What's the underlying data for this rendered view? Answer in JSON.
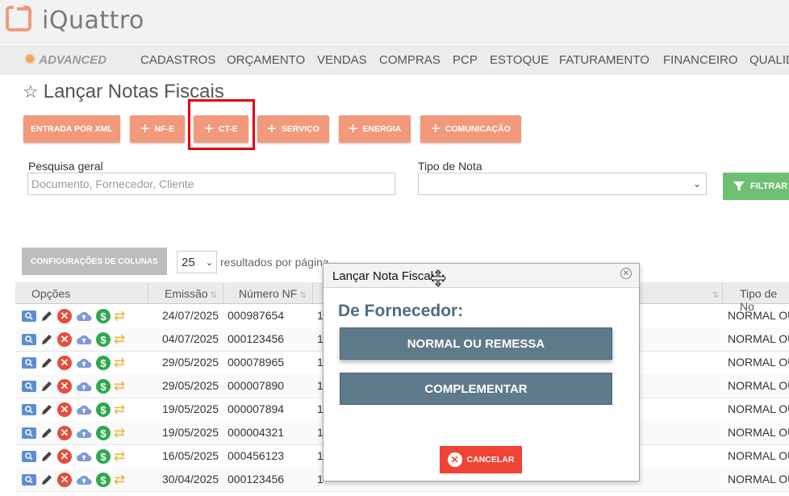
{
  "app": {
    "name": "iQuattro",
    "edition": "ADVANCED"
  },
  "nav": {
    "items": [
      "CADASTROS",
      "ORÇAMENTO",
      "VENDAS",
      "COMPRAS",
      "PCP",
      "ESTOQUE",
      "FATURAMENTO",
      "FINANCEIRO",
      "QUALID"
    ]
  },
  "page": {
    "title": "Lançar Notas Fiscais"
  },
  "actions": {
    "entrada_xml": "ENTRADA POR XML",
    "nfe": "NF-E",
    "cte": "CT-E",
    "servico": "SERVIÇO",
    "energia": "ENERGIA",
    "comunicacao": "COMUNICAÇÃO"
  },
  "filters": {
    "search_label": "Pesquisa geral",
    "search_placeholder": "Documento, Fornecedor, Cliente",
    "tipo_label": "Tipo de Nota",
    "tipo_value": "",
    "filter_button": "FILTRAR"
  },
  "table_controls": {
    "col_config": "CONFIGURAÇÕES DE COLUNAS",
    "page_size": "25",
    "page_size_label": "resultados por página"
  },
  "table": {
    "headers": {
      "opcoes": "Opções",
      "emissao": "Emissão",
      "numero": "Número NF",
      "tipo": "Tipo de No"
    },
    "rows": [
      {
        "emissao": "24/07/2025",
        "numero": "000987654",
        "col3": "1",
        "tipo": "NORMAL OU"
      },
      {
        "emissao": "04/07/2025",
        "numero": "000123456",
        "col3": "1",
        "tipo": "NORMAL OU"
      },
      {
        "emissao": "29/05/2025",
        "numero": "000078965",
        "col3": "1",
        "tipo": "NORMAL OU"
      },
      {
        "emissao": "29/05/2025",
        "numero": "000007890",
        "col3": "1",
        "tipo": "NORMAL OU"
      },
      {
        "emissao": "19/05/2025",
        "numero": "000007894",
        "col3": "1",
        "tipo": "NORMAL OU"
      },
      {
        "emissao": "19/05/2025",
        "numero": "000004321",
        "col3": "1",
        "tipo": "NORMAL OU"
      },
      {
        "emissao": "16/05/2025",
        "numero": "000456123",
        "col3": "1",
        "tipo": "NORMAL OU"
      },
      {
        "emissao": "30/04/2025",
        "numero": "000123456",
        "col3": "1",
        "tipo": "NORMAL OU"
      }
    ]
  },
  "dialog": {
    "title": "Lançar Nota Fiscal",
    "subtitle": "De Fornecedor:",
    "btn_normal": "NORMAL OU REMESSA",
    "btn_complementar": "COMPLEMENTAR",
    "btn_cancel": "CANCELAR"
  },
  "colors": {
    "accent": "#f2997c",
    "highlight": "#e5000b",
    "dialog_button": "#5f7a8a",
    "cancel": "#f04437",
    "filter": "#6fbf73"
  }
}
